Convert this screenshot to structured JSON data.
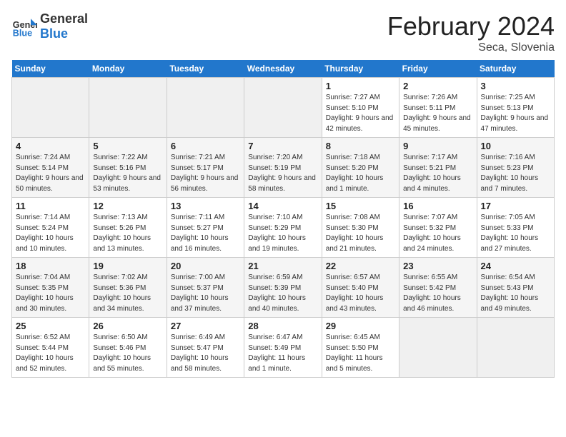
{
  "header": {
    "logo_general": "General",
    "logo_blue": "Blue",
    "month": "February 2024",
    "location": "Seca, Slovenia"
  },
  "days_of_week": [
    "Sunday",
    "Monday",
    "Tuesday",
    "Wednesday",
    "Thursday",
    "Friday",
    "Saturday"
  ],
  "weeks": [
    [
      {
        "day": "",
        "empty": true
      },
      {
        "day": "",
        "empty": true
      },
      {
        "day": "",
        "empty": true
      },
      {
        "day": "",
        "empty": true
      },
      {
        "day": "1",
        "sunrise": "7:27 AM",
        "sunset": "5:10 PM",
        "daylight": "9 hours and 42 minutes."
      },
      {
        "day": "2",
        "sunrise": "7:26 AM",
        "sunset": "5:11 PM",
        "daylight": "9 hours and 45 minutes."
      },
      {
        "day": "3",
        "sunrise": "7:25 AM",
        "sunset": "5:13 PM",
        "daylight": "9 hours and 47 minutes."
      }
    ],
    [
      {
        "day": "4",
        "sunrise": "7:24 AM",
        "sunset": "5:14 PM",
        "daylight": "9 hours and 50 minutes."
      },
      {
        "day": "5",
        "sunrise": "7:22 AM",
        "sunset": "5:16 PM",
        "daylight": "9 hours and 53 minutes."
      },
      {
        "day": "6",
        "sunrise": "7:21 AM",
        "sunset": "5:17 PM",
        "daylight": "9 hours and 56 minutes."
      },
      {
        "day": "7",
        "sunrise": "7:20 AM",
        "sunset": "5:19 PM",
        "daylight": "9 hours and 58 minutes."
      },
      {
        "day": "8",
        "sunrise": "7:18 AM",
        "sunset": "5:20 PM",
        "daylight": "10 hours and 1 minute."
      },
      {
        "day": "9",
        "sunrise": "7:17 AM",
        "sunset": "5:21 PM",
        "daylight": "10 hours and 4 minutes."
      },
      {
        "day": "10",
        "sunrise": "7:16 AM",
        "sunset": "5:23 PM",
        "daylight": "10 hours and 7 minutes."
      }
    ],
    [
      {
        "day": "11",
        "sunrise": "7:14 AM",
        "sunset": "5:24 PM",
        "daylight": "10 hours and 10 minutes."
      },
      {
        "day": "12",
        "sunrise": "7:13 AM",
        "sunset": "5:26 PM",
        "daylight": "10 hours and 13 minutes."
      },
      {
        "day": "13",
        "sunrise": "7:11 AM",
        "sunset": "5:27 PM",
        "daylight": "10 hours and 16 minutes."
      },
      {
        "day": "14",
        "sunrise": "7:10 AM",
        "sunset": "5:29 PM",
        "daylight": "10 hours and 19 minutes."
      },
      {
        "day": "15",
        "sunrise": "7:08 AM",
        "sunset": "5:30 PM",
        "daylight": "10 hours and 21 minutes."
      },
      {
        "day": "16",
        "sunrise": "7:07 AM",
        "sunset": "5:32 PM",
        "daylight": "10 hours and 24 minutes."
      },
      {
        "day": "17",
        "sunrise": "7:05 AM",
        "sunset": "5:33 PM",
        "daylight": "10 hours and 27 minutes."
      }
    ],
    [
      {
        "day": "18",
        "sunrise": "7:04 AM",
        "sunset": "5:35 PM",
        "daylight": "10 hours and 30 minutes."
      },
      {
        "day": "19",
        "sunrise": "7:02 AM",
        "sunset": "5:36 PM",
        "daylight": "10 hours and 34 minutes."
      },
      {
        "day": "20",
        "sunrise": "7:00 AM",
        "sunset": "5:37 PM",
        "daylight": "10 hours and 37 minutes."
      },
      {
        "day": "21",
        "sunrise": "6:59 AM",
        "sunset": "5:39 PM",
        "daylight": "10 hours and 40 minutes."
      },
      {
        "day": "22",
        "sunrise": "6:57 AM",
        "sunset": "5:40 PM",
        "daylight": "10 hours and 43 minutes."
      },
      {
        "day": "23",
        "sunrise": "6:55 AM",
        "sunset": "5:42 PM",
        "daylight": "10 hours and 46 minutes."
      },
      {
        "day": "24",
        "sunrise": "6:54 AM",
        "sunset": "5:43 PM",
        "daylight": "10 hours and 49 minutes."
      }
    ],
    [
      {
        "day": "25",
        "sunrise": "6:52 AM",
        "sunset": "5:44 PM",
        "daylight": "10 hours and 52 minutes."
      },
      {
        "day": "26",
        "sunrise": "6:50 AM",
        "sunset": "5:46 PM",
        "daylight": "10 hours and 55 minutes."
      },
      {
        "day": "27",
        "sunrise": "6:49 AM",
        "sunset": "5:47 PM",
        "daylight": "10 hours and 58 minutes."
      },
      {
        "day": "28",
        "sunrise": "6:47 AM",
        "sunset": "5:49 PM",
        "daylight": "11 hours and 1 minute."
      },
      {
        "day": "29",
        "sunrise": "6:45 AM",
        "sunset": "5:50 PM",
        "daylight": "11 hours and 5 minutes."
      },
      {
        "day": "",
        "empty": true
      },
      {
        "day": "",
        "empty": true
      }
    ]
  ],
  "labels": {
    "sunrise": "Sunrise:",
    "sunset": "Sunset:",
    "daylight": "Daylight:"
  }
}
